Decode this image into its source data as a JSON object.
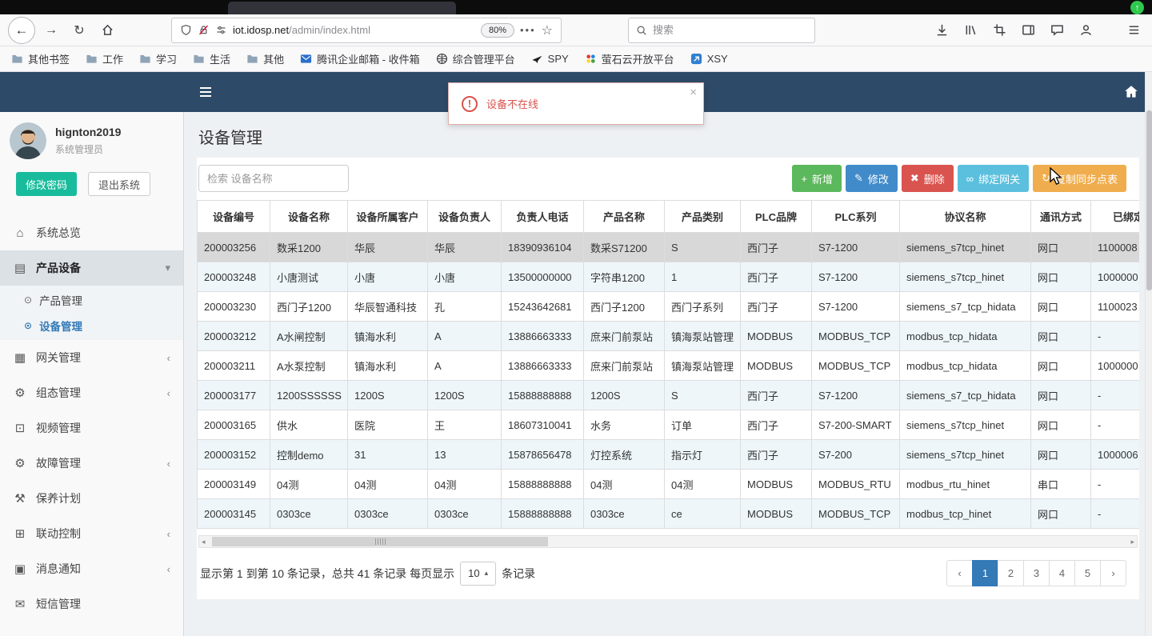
{
  "browser": {
    "url": {
      "host": "iot.idosp.net",
      "path": "/admin/index.html"
    },
    "zoom_level": "80%",
    "search_placeholder": "搜索",
    "bookmarks": [
      {
        "label": "其他书签",
        "icon": "folder"
      },
      {
        "label": "工作",
        "icon": "folder"
      },
      {
        "label": "学习",
        "icon": "folder"
      },
      {
        "label": "生活",
        "icon": "folder"
      },
      {
        "label": "其他",
        "icon": "folder"
      },
      {
        "label": "腾讯企业邮箱 - 收件箱",
        "icon": "mail"
      },
      {
        "label": "综合管理平台",
        "icon": "globe"
      },
      {
        "label": "SPY",
        "icon": "plane"
      },
      {
        "label": "萤石云开放平台",
        "icon": "dots"
      },
      {
        "label": "XSY",
        "icon": "xsy"
      }
    ]
  },
  "app": {
    "alert": {
      "message": "设备不在线",
      "close_label": "×",
      "icon": "exclamation-circle"
    },
    "user": {
      "name": "hignton2019",
      "role": "系统管理员"
    },
    "sidebar": {
      "change_password": "修改密码",
      "logout": "退出系统",
      "menu": [
        {
          "key": "overview",
          "label": "系统总览",
          "icon": "home"
        },
        {
          "key": "product-device",
          "label": "产品设备",
          "icon": "devices",
          "state": "expanded",
          "children": [
            {
              "key": "product-mgmt",
              "label": "产品管理",
              "active": false
            },
            {
              "key": "device-mgmt",
              "label": "设备管理",
              "active": true
            }
          ]
        },
        {
          "key": "gateway-mgmt",
          "label": "网关管理",
          "icon": "gateway",
          "state": "collapsed"
        },
        {
          "key": "config-mgmt",
          "label": "组态管理",
          "icon": "config",
          "state": "collapsed"
        },
        {
          "key": "video-mgmt",
          "label": "视频管理",
          "icon": "video"
        },
        {
          "key": "fault-mgmt",
          "label": "故障管理",
          "icon": "fault",
          "state": "collapsed"
        },
        {
          "key": "maintenance-plan",
          "label": "保养计划",
          "icon": "maintenance"
        },
        {
          "key": "linkage-control",
          "label": "联动控制",
          "icon": "linkage",
          "state": "collapsed"
        },
        {
          "key": "message-notify",
          "label": "消息通知",
          "icon": "message",
          "state": "collapsed"
        },
        {
          "key": "sms-mgmt",
          "label": "短信管理",
          "icon": "sms"
        }
      ]
    },
    "page": {
      "title": "设备管理",
      "search_placeholder": "检索 设备名称",
      "buttons": [
        {
          "key": "add",
          "label": "新增",
          "icon": "plus",
          "color": "#5cb85c"
        },
        {
          "key": "edit",
          "label": "修改",
          "icon": "pencil",
          "color": "#428bca"
        },
        {
          "key": "delete",
          "label": "删除",
          "icon": "x",
          "color": "#d9534f"
        },
        {
          "key": "bind-gateway",
          "label": "绑定网关",
          "icon": "link",
          "color": "#5bc0de"
        },
        {
          "key": "copy-sync-table",
          "label": "复制同步点表",
          "icon": "refresh",
          "color": "#f0ad4e"
        }
      ],
      "table": {
        "columns": [
          "设备编号",
          "设备名称",
          "设备所属客户",
          "设备负责人",
          "负责人电话",
          "产品名称",
          "产品类别",
          "PLC品牌",
          "PLC系列",
          "协议名称",
          "通讯方式",
          "已绑定网关"
        ],
        "selected_row": 0,
        "rows": [
          [
            "200003256",
            "数采1200",
            "华辰",
            "华辰",
            "18390936104",
            "数采S71200",
            "S",
            "西门子",
            "S7-1200",
            "siemens_s7tcp_hinet",
            "网口",
            "1100008"
          ],
          [
            "200003248",
            "小唐测试",
            "小唐",
            "小唐",
            "13500000000",
            "字符串1200",
            "1",
            "西门子",
            "S7-1200",
            "siemens_s7tcp_hinet",
            "网口",
            "1000000"
          ],
          [
            "200003230",
            "西门子1200",
            "华辰智通科技",
            "孔",
            "15243642681",
            "西门子1200",
            "西门子系列",
            "西门子",
            "S7-1200",
            "siemens_s7_tcp_hidata",
            "网口",
            "1100023"
          ],
          [
            "200003212",
            "A水闸控制",
            "镇海水利",
            "A",
            "13886663333",
            "庶来门前泵站",
            "镇海泵站管理",
            "MODBUS",
            "MODBUS_TCP",
            "modbus_tcp_hidata",
            "网口",
            "-"
          ],
          [
            "200003211",
            "A水泵控制",
            "镇海水利",
            "A",
            "13886663333",
            "庶来门前泵站",
            "镇海泵站管理",
            "MODBUS",
            "MODBUS_TCP",
            "modbus_tcp_hidata",
            "网口",
            "1000000"
          ],
          [
            "200003177",
            "1200SSSSSS",
            "1200S",
            "1200S",
            "15888888888",
            "1200S",
            "S",
            "西门子",
            "S7-1200",
            "siemens_s7_tcp_hidata",
            "网口",
            "-"
          ],
          [
            "200003165",
            "供水",
            "医院",
            "王",
            "18607310041",
            "水务",
            "订单",
            "西门子",
            "S7-200-SMART",
            "siemens_s7tcp_hinet",
            "网口",
            "-"
          ],
          [
            "200003152",
            "控制demo",
            "31",
            "13",
            "15878656478",
            "灯控系统",
            "指示灯",
            "西门子",
            "S7-200",
            "siemens_s7tcp_hinet",
            "网口",
            "1000006"
          ],
          [
            "200003149",
            "04测",
            "04测",
            "04测",
            "15888888888",
            "04测",
            "04测",
            "MODBUS",
            "MODBUS_RTU",
            "modbus_rtu_hinet",
            "串口",
            "-"
          ],
          [
            "200003145",
            "0303ce",
            "0303ce",
            "0303ce",
            "15888888888",
            "0303ce",
            "ce",
            "MODBUS",
            "MODBUS_TCP",
            "modbus_tcp_hinet",
            "网口",
            "-"
          ]
        ]
      },
      "pagination": {
        "info_prefix": "显示第 1 到第 10 条记录，总共 41 条记录 每页显示",
        "page_size": "10",
        "info_suffix": "条记录",
        "pages": [
          "1",
          "2",
          "3",
          "4",
          "5"
        ],
        "active_page": "1"
      }
    }
  }
}
